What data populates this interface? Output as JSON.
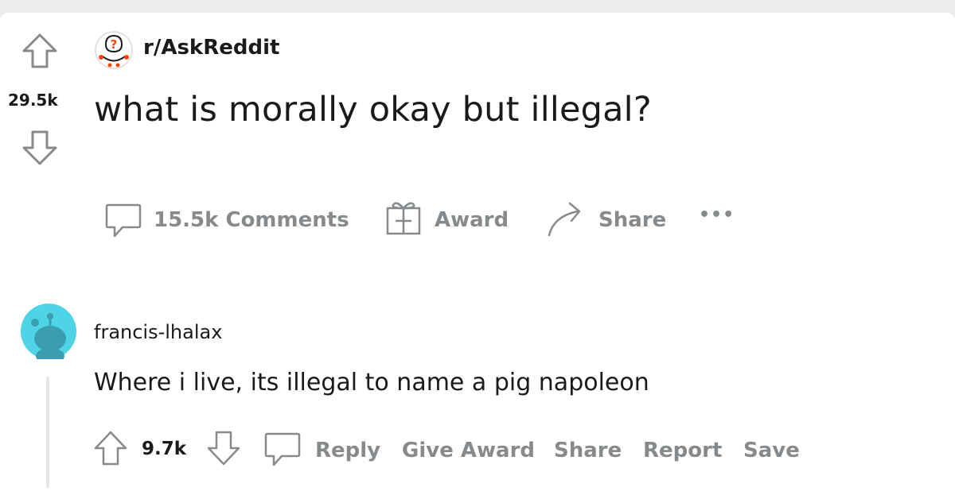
{
  "post": {
    "subreddit": "r/AskReddit",
    "score": "29.5k",
    "title": "what is morally okay but illegal?",
    "actions": {
      "comments": "15.5k Comments",
      "award": "Award",
      "share": "Share",
      "more": "•••"
    }
  },
  "comment": {
    "username": "francis-lhalax",
    "body": "Where i live, its illegal to name a pig napoleon",
    "score": "9.7k",
    "actions": {
      "reply": "Reply",
      "give_award": "Give Award",
      "share": "Share",
      "report": "Report",
      "save": "Save"
    }
  },
  "colors": {
    "muted": "#878a8c",
    "avatar_bg": "#4fd3e6",
    "text": "#1a1a1b"
  }
}
